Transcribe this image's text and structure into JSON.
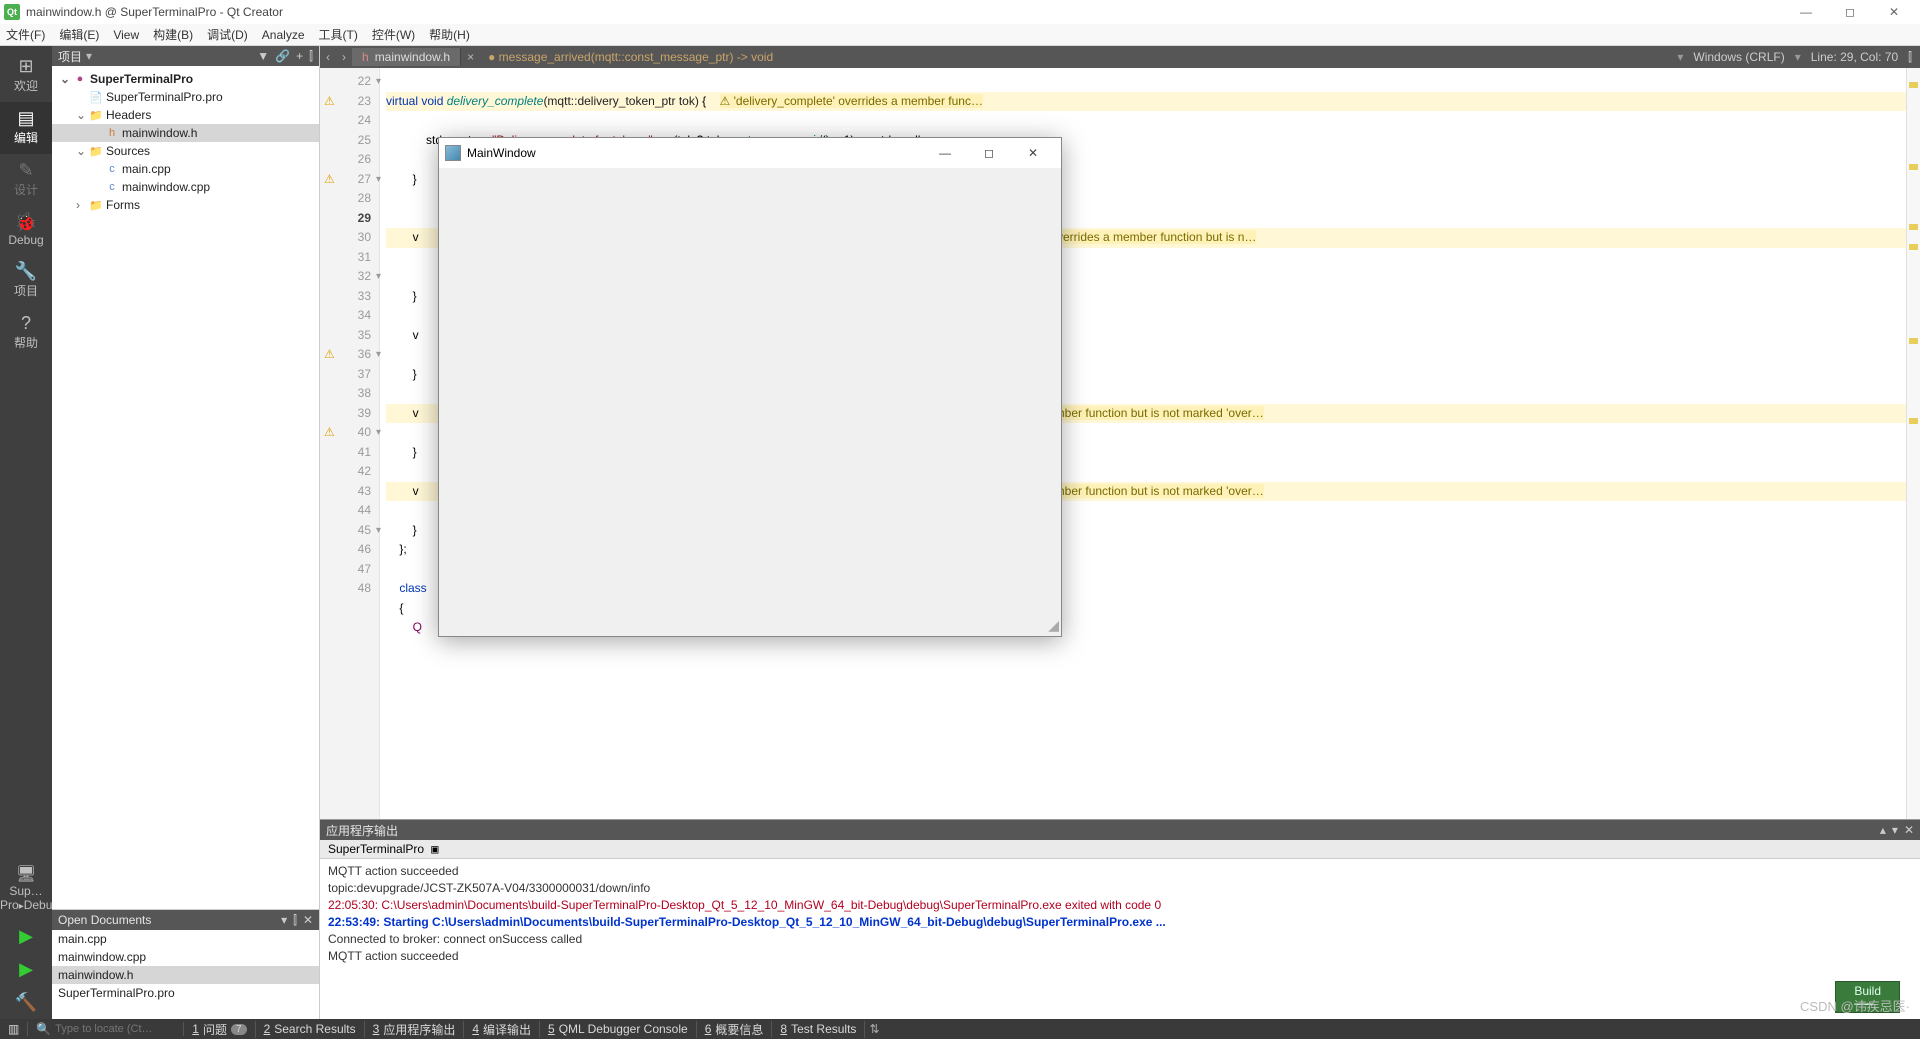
{
  "window": {
    "title": "mainwindow.h @ SuperTerminalPro - Qt Creator"
  },
  "menu": [
    "文件(F)",
    "编辑(E)",
    "View",
    "构建(B)",
    "调试(D)",
    "Analyze",
    "工具(T)",
    "控件(W)",
    "帮助(H)"
  ],
  "modebar": {
    "items": [
      {
        "glyph": "⊞",
        "label": "欢迎"
      },
      {
        "glyph": "▤",
        "label": "编辑",
        "active": true
      },
      {
        "glyph": "✎",
        "label": "设计"
      },
      {
        "glyph": "🐞",
        "label": "Debug"
      },
      {
        "glyph": "🔧",
        "label": "项目"
      },
      {
        "glyph": "?",
        "label": "帮助"
      }
    ],
    "kit": "Sup…Pro",
    "config": "Debug",
    "run_glyph": "▶",
    "rundbg_glyph": "▶",
    "hammer_glyph": "🔨"
  },
  "project_pane": {
    "title": "项目",
    "tree": [
      {
        "lvl": 0,
        "caret": "⌄",
        "icon": "●",
        "label": "SuperTerminalPro",
        "bold": true,
        "color": "#b04590"
      },
      {
        "lvl": 1,
        "caret": "",
        "icon": "📄",
        "label": "SuperTerminalPro.pro"
      },
      {
        "lvl": 1,
        "caret": "⌄",
        "icon": "📁",
        "label": "Headers",
        "fcolor": "#d8a33a"
      },
      {
        "lvl": 2,
        "caret": "",
        "icon": "h",
        "label": "mainwindow.h",
        "sel": true,
        "fcolor": "#c97a3a"
      },
      {
        "lvl": 1,
        "caret": "⌄",
        "icon": "📁",
        "label": "Sources",
        "fcolor": "#d8a33a"
      },
      {
        "lvl": 2,
        "caret": "",
        "icon": "c",
        "label": "main.cpp",
        "fcolor": "#5a8ac9"
      },
      {
        "lvl": 2,
        "caret": "",
        "icon": "c",
        "label": "mainwindow.cpp",
        "fcolor": "#5a8ac9"
      },
      {
        "lvl": 1,
        "caret": "›",
        "icon": "📁",
        "label": "Forms",
        "fcolor": "#d8a33a"
      }
    ]
  },
  "open_docs": {
    "title": "Open Documents",
    "items": [
      "main.cpp",
      "mainwindow.cpp",
      "mainwindow.h",
      "SuperTerminalPro.pro"
    ],
    "selected": "mainwindow.h"
  },
  "doc_tab": {
    "file": "mainwindow.h",
    "crumb": "message_arrived(mqtt::const_message_ptr) -> void"
  },
  "editor_status": {
    "encoding": "Windows (CRLF)",
    "pos": "Line: 29, Col: 70"
  },
  "gutter": [
    {
      "n": 22,
      "fold": "▾"
    },
    {
      "n": 23,
      "warn": true
    },
    {
      "n": 24
    },
    {
      "n": 25
    },
    {
      "n": 26
    },
    {
      "n": 27,
      "warn": true,
      "fold": "▾"
    },
    {
      "n": 28
    },
    {
      "n": 29,
      "bold": true
    },
    {
      "n": 30
    },
    {
      "n": 31
    },
    {
      "n": 32,
      "fold": "▾"
    },
    {
      "n": 33
    },
    {
      "n": 34
    },
    {
      "n": 35
    },
    {
      "n": 36,
      "warn": true,
      "fold": "▾"
    },
    {
      "n": 37
    },
    {
      "n": 38
    },
    {
      "n": 39
    },
    {
      "n": 40,
      "warn": true,
      "fold": "▾"
    },
    {
      "n": 41
    },
    {
      "n": 42
    },
    {
      "n": 43
    },
    {
      "n": 44
    },
    {
      "n": 45,
      "fold": "▾"
    },
    {
      "n": 46
    },
    {
      "n": 47
    },
    {
      "n": 48
    }
  ],
  "code": {
    "l22": "",
    "l23_pre": "        virtual void ",
    "l23_fn": "delivery_complete",
    "l23_post": "(mqtt::delivery_token_ptr tok) {    ",
    "l23_hint": "⚠ 'delivery_complete' overrides a member func…",
    "l24_a": "            std::cout << ",
    "l24_s": "\"Delivery complete for token: \"",
    "l24_b": " << (tok ? tok->",
    "l24_fn": "get_message_id",
    "l24_c": "() : -1) << std::endl;",
    "l25": "        }",
    "l27_pre": "        v",
    "l27_hint": "rived' overrides a member function but is n…",
    "l30": "        }",
    "l32": "        v",
    "l34": "        }",
    "l36_pre": "        v",
    "l36_hint": "s a member function but is not marked 'over…",
    "l38": "        }",
    "l40_pre": "        v",
    "l40_hint": "s a member function but is not marked 'over…",
    "l42": "        }",
    "l43": "    };",
    "l45": "    class",
    "l46": "    {",
    "l47": "        Q"
  },
  "child_window": {
    "title": "MainWindow"
  },
  "output": {
    "title": "应用程序输出",
    "tab": "SuperTerminalPro",
    "lines": [
      {
        "t": "MQTT action succeeded"
      },
      {
        "t": "topic:devupgrade/JCST-ZK507A-V04/3300000031/down/info"
      },
      {
        "t": "22:05:30: C:\\Users\\admin\\Documents\\build-SuperTerminalPro-Desktop_Qt_5_12_10_MinGW_64_bit-Debug\\debug\\SuperTerminalPro.exe exited with code 0",
        "cls": "red"
      },
      {
        "t": ""
      },
      {
        "t": "22:53:49: Starting C:\\Users\\admin\\Documents\\build-SuperTerminalPro-Desktop_Qt_5_12_10_MinGW_64_bit-Debug\\debug\\SuperTerminalPro.exe ...",
        "cls": "blue"
      },
      {
        "t": "Connected to broker: connect onSuccess called"
      },
      {
        "t": "MQTT action succeeded"
      }
    ]
  },
  "build_badge": "Build",
  "statusbar": {
    "locator_icon": "🔍",
    "locator_ph": "Type to locate (Ct…",
    "items": [
      {
        "n": "1",
        "t": "问题",
        "badge": "7"
      },
      {
        "n": "2",
        "t": "Search Results"
      },
      {
        "n": "3",
        "t": "应用程序输出"
      },
      {
        "n": "4",
        "t": "编译输出"
      },
      {
        "n": "5",
        "t": "QML Debugger Console"
      },
      {
        "n": "6",
        "t": "概要信息"
      },
      {
        "n": "8",
        "t": "Test Results"
      }
    ]
  },
  "watermark": "CSDN @讳疾忌医·"
}
